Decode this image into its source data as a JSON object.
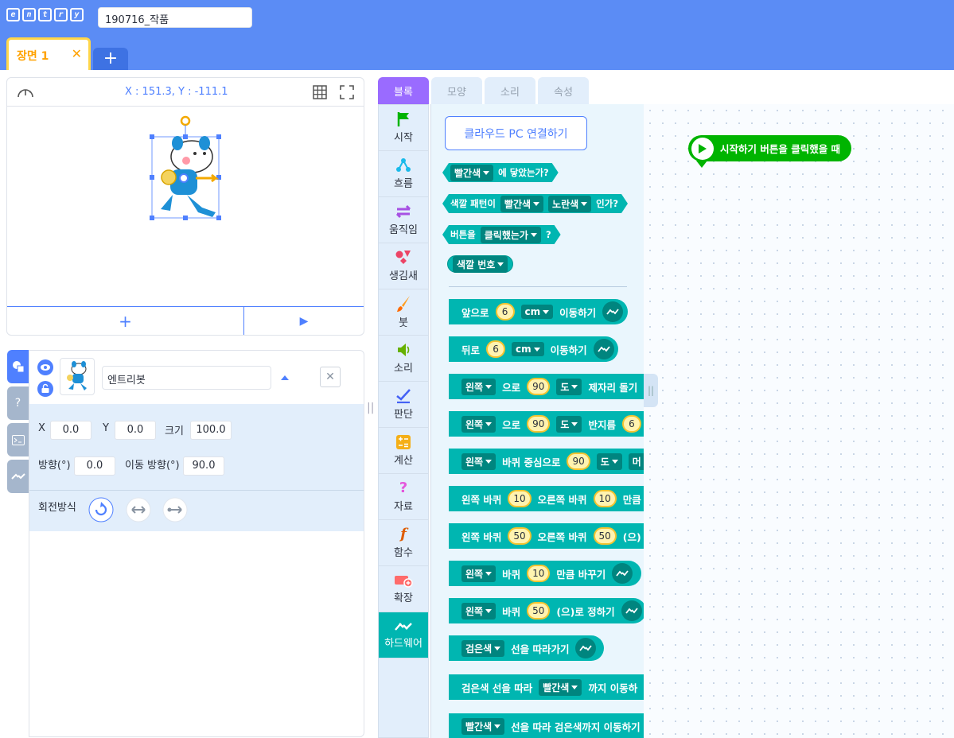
{
  "app": {
    "logo_letters": [
      "e",
      "n",
      "t",
      "r",
      "y"
    ],
    "project_name": "190716_작품",
    "scene_tab": "장면 1",
    "scene_close": "✕",
    "scene_add": "+"
  },
  "stage": {
    "coord": "X : 151.3, Y : -111.1",
    "add_object": "+",
    "start": "▶"
  },
  "object": {
    "name": "엔트리봇",
    "labels": {
      "x": "X",
      "y": "Y",
      "size": "크기",
      "direction": "방향(°)",
      "move_direction": "이동 방향(°)",
      "rotation": "회전방식"
    },
    "values": {
      "x": "0.0",
      "y": "0.0",
      "size": "100.0",
      "direction": "0.0",
      "move_direction": "90.0"
    },
    "close": "✕",
    "side_tab_help": "?"
  },
  "block_tabs": [
    "블록",
    "모양",
    "소리",
    "속성"
  ],
  "categories": [
    {
      "label": "시작",
      "icon": "flag-icon",
      "color": "#00b400"
    },
    {
      "label": "흐름",
      "icon": "flow-icon",
      "color": "#19baea"
    },
    {
      "label": "움직임",
      "icon": "move-icon",
      "color": "#a751e3"
    },
    {
      "label": "생김새",
      "icon": "looks-icon",
      "color": "#ec4466"
    },
    {
      "label": "붓",
      "icon": "brush-icon",
      "color": "#ff9e20"
    },
    {
      "label": "소리",
      "icon": "sound-icon",
      "color": "#67b100"
    },
    {
      "label": "판단",
      "icon": "judge-icon",
      "color": "#4562f5"
    },
    {
      "label": "계산",
      "icon": "calc-icon",
      "color": "#f4af18"
    },
    {
      "label": "자료",
      "icon": "data-icon",
      "color": "#e457dc"
    },
    {
      "label": "함수",
      "icon": "function-icon",
      "color": "#de5c04"
    },
    {
      "label": "확장",
      "icon": "extension-icon",
      "color": "#ff8888"
    },
    {
      "label": "하드웨어",
      "icon": "hardware-icon",
      "color": "#00b6b1"
    }
  ],
  "palette": {
    "cloud_button": "클라우드 PC 연결하기",
    "b1": {
      "dd": "빨간색",
      "text": "에 닿았는가?"
    },
    "b2": {
      "t1": "색깔 패턴이",
      "dd1": "빨간색",
      "dd2": "노란색",
      "t2": "인가?"
    },
    "b3": {
      "t1": "버튼을",
      "dd": "클릭했는가",
      "t2": "?"
    },
    "b4": {
      "dd": "색깔 번호"
    },
    "b5": {
      "t1": "앞으로",
      "n": "6",
      "dd": "cm",
      "t2": "이동하기"
    },
    "b6": {
      "t1": "뒤로",
      "n": "6",
      "dd": "cm",
      "t2": "이동하기"
    },
    "b7": {
      "dd1": "왼쪽",
      "t1": "으로",
      "n": "90",
      "dd2": "도",
      "t2": "제자리 돌기"
    },
    "b8": {
      "dd1": "왼쪽",
      "t1": "으로",
      "n": "90",
      "dd2": "도",
      "t2": "반지름",
      "n2": "6"
    },
    "b9": {
      "dd1": "왼쪽",
      "t1": "바퀴 중심으로",
      "n": "90",
      "dd2": "도",
      "dd3": "머"
    },
    "b10": {
      "t1": "왼쪽 바퀴",
      "n1": "10",
      "t2": "오른쪽 바퀴",
      "n2": "10",
      "t3": "만큼"
    },
    "b11": {
      "t1": "왼쪽 바퀴",
      "n1": "50",
      "t2": "오른쪽 바퀴",
      "n2": "50",
      "t3": "(으)"
    },
    "b12": {
      "dd": "왼쪽",
      "t1": "바퀴",
      "n": "10",
      "t2": "만큼 바꾸기"
    },
    "b13": {
      "dd": "왼쪽",
      "t1": "바퀴",
      "n": "50",
      "t2": "(으)로 정하기"
    },
    "b14": {
      "dd": "검은색",
      "t1": "선을 따라가기"
    },
    "b15": {
      "t1": "검은색 선을 따라",
      "dd": "빨간색",
      "t2": "까지 이동하"
    },
    "b16": {
      "dd": "빨간색",
      "t1": "선을 따라 검은색까지 이동하기"
    }
  },
  "workspace": {
    "start_block": "시작하기 버튼을 클릭했을 때"
  }
}
